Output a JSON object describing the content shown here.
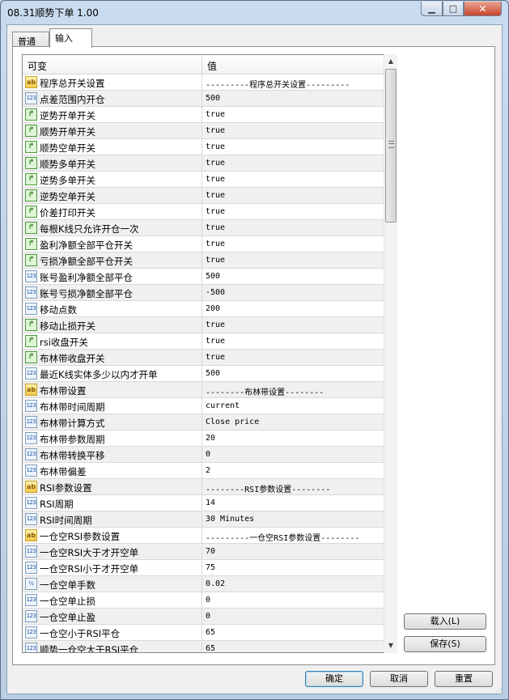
{
  "window": {
    "title": "08.31顺势下单 1.00",
    "minimize_icon": "minimize-icon",
    "maximize_icon": "maximize-icon",
    "close_icon": "close-icon"
  },
  "tabs": [
    {
      "label": "普通"
    },
    {
      "label": "输入"
    }
  ],
  "grid": {
    "header": {
      "variable": "可变",
      "value": "值"
    },
    "rows": [
      {
        "icon": "ab",
        "name": "程序总开关设置",
        "value": "---------程序总开关设置---------"
      },
      {
        "icon": "123",
        "name": "点差范围内开仓",
        "value": "500"
      },
      {
        "icon": "bool",
        "name": "逆势开单开关",
        "value": "true"
      },
      {
        "icon": "bool",
        "name": "顺势开单开关",
        "value": "true"
      },
      {
        "icon": "bool",
        "name": "顺势空单开关",
        "value": "true"
      },
      {
        "icon": "bool",
        "name": "顺势多单开关",
        "value": "true"
      },
      {
        "icon": "bool",
        "name": "逆势多单开关",
        "value": "true"
      },
      {
        "icon": "bool",
        "name": "逆势空单开关",
        "value": "true"
      },
      {
        "icon": "bool",
        "name": "价差打印开关",
        "value": "true"
      },
      {
        "icon": "bool",
        "name": "每根K线只允许开仓一次",
        "value": "true"
      },
      {
        "icon": "bool",
        "name": "盈利净额全部平仓开关",
        "value": "true"
      },
      {
        "icon": "bool",
        "name": "亏损净额全部平仓开关",
        "value": "true"
      },
      {
        "icon": "123",
        "name": "账号盈利净额全部平仓",
        "value": "500"
      },
      {
        "icon": "123",
        "name": "账号亏损净额全部平仓",
        "value": "-500"
      },
      {
        "icon": "123",
        "name": "移动点数",
        "value": "200"
      },
      {
        "icon": "bool",
        "name": "移动止损开关",
        "value": "true"
      },
      {
        "icon": "bool",
        "name": "rsi收盘开关",
        "value": "true"
      },
      {
        "icon": "bool",
        "name": "布林带收盘开关",
        "value": "true"
      },
      {
        "icon": "123",
        "name": "最近K线实体多少以内才开单",
        "value": "500"
      },
      {
        "icon": "ab",
        "name": "布林带设置",
        "value": "--------布林带设置--------"
      },
      {
        "icon": "123",
        "name": "布林带时间周期",
        "value": "current"
      },
      {
        "icon": "123",
        "name": "布林带计算方式",
        "value": "Close price"
      },
      {
        "icon": "123",
        "name": "布林带参数周期",
        "value": "20"
      },
      {
        "icon": "123",
        "name": "布林带转换平移",
        "value": "0"
      },
      {
        "icon": "123",
        "name": "布林带偏差",
        "value": "2"
      },
      {
        "icon": "ab",
        "name": "RSI参数设置",
        "value": "--------RSI参数设置--------"
      },
      {
        "icon": "123",
        "name": "RSI周期",
        "value": "14"
      },
      {
        "icon": "123",
        "name": "RSI时间周期",
        "value": "30 Minutes"
      },
      {
        "icon": "ab",
        "name": "一仓空RSI参数设置",
        "value": "---------一仓空RSI参数设置--------"
      },
      {
        "icon": "123",
        "name": "一仓空RSI大于才开空单",
        "value": "70"
      },
      {
        "icon": "123",
        "name": "一仓空RSI小于才开空单",
        "value": "75"
      },
      {
        "icon": "1/2",
        "name": "一仓空单手数",
        "value": "0.02"
      },
      {
        "icon": "123",
        "name": "一仓空单止损",
        "value": "0"
      },
      {
        "icon": "123",
        "name": "一仓空单止盈",
        "value": "0"
      },
      {
        "icon": "123",
        "name": "一仓空小于RSI平仓",
        "value": "65"
      },
      {
        "icon": "123",
        "name": "顺势一仓空大于RSI平仓",
        "value": "65"
      }
    ]
  },
  "side_buttons": {
    "load": "载入(L)",
    "save": "保存(S)"
  },
  "footer_buttons": {
    "ok": "确定",
    "cancel": "取消",
    "reset": "重置"
  }
}
